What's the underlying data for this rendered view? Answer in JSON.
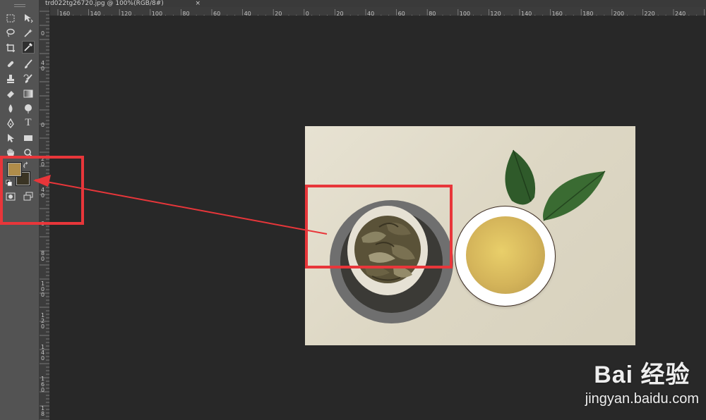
{
  "document": {
    "tab_title": "trd022tg26720.jpg @ 100%(RGB/8#)",
    "close_glyph": "×"
  },
  "colors": {
    "app_background": "#282828",
    "toolbox": "#535353",
    "foreground_color": "#b08d4a",
    "background_color": "#3a3424",
    "annotation_red": "#e8363a"
  },
  "toolbox": {
    "tools": [
      {
        "name": "marquee-tool-icon"
      },
      {
        "name": "move-tool-icon"
      },
      {
        "name": "lasso-tool-icon"
      },
      {
        "name": "magic-wand-tool-icon"
      },
      {
        "name": "crop-tool-icon"
      },
      {
        "name": "eyedropper-tool-icon",
        "active": true
      },
      {
        "name": "healing-brush-tool-icon"
      },
      {
        "name": "brush-tool-icon"
      },
      {
        "name": "clone-stamp-tool-icon"
      },
      {
        "name": "history-brush-tool-icon"
      },
      {
        "name": "eraser-tool-icon"
      },
      {
        "name": "gradient-tool-icon"
      },
      {
        "name": "blur-tool-icon"
      },
      {
        "name": "dodge-tool-icon"
      },
      {
        "name": "pen-tool-icon"
      },
      {
        "name": "type-tool-icon"
      },
      {
        "name": "path-selection-tool-icon"
      },
      {
        "name": "rectangle-tool-icon"
      },
      {
        "name": "hand-tool-icon"
      },
      {
        "name": "zoom-tool-icon"
      },
      {
        "name": "quick-mask-icon"
      },
      {
        "name": "screen-mode-icon"
      }
    ],
    "type_glyph": "T"
  },
  "ruler_top": {
    "labels": [
      "160",
      "140",
      "120",
      "100",
      "80",
      "60",
      "40",
      "20",
      "0",
      "20",
      "40",
      "60",
      "80",
      "100",
      "120",
      "140",
      "160",
      "180",
      "200",
      "220",
      "240"
    ]
  },
  "ruler_left": {
    "labels": [
      "0",
      "4\n0",
      "0",
      "2\n0",
      "4\n0",
      "0",
      "8\n0",
      "1\n0\n0",
      "1\n2\n0",
      "1\n4\n0",
      "1\n6\n0",
      "1\n8"
    ]
  },
  "watermark": {
    "logo": "Bai 经验",
    "url": "jingyan.baidu.com"
  }
}
